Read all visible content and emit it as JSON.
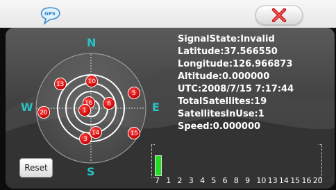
{
  "colors": {
    "accent": "#29c3c3",
    "satellite": "#dd0000",
    "bar": "#22dd22"
  },
  "header": {
    "logo_text": "GPS",
    "close_icon": "close-x-icon"
  },
  "compass": {
    "n": "N",
    "e": "E",
    "s": "S",
    "w": "W"
  },
  "satellites": [
    {
      "id": "10",
      "azimuth_deg": 2,
      "elevation_deg": 45
    },
    {
      "id": "13",
      "azimuth_deg": 308,
      "elevation_deg": 26
    },
    {
      "id": "5",
      "azimuth_deg": 70,
      "elevation_deg": 15
    },
    {
      "id": "6",
      "azimuth_deg": 74,
      "elevation_deg": 59
    },
    {
      "id": "16",
      "azimuth_deg": 338,
      "elevation_deg": 80
    },
    {
      "id": "20",
      "azimuth_deg": 265,
      "elevation_deg": 12
    },
    {
      "id": "1",
      "azimuth_deg": 250,
      "elevation_deg": 79
    },
    {
      "id": "15",
      "azimuth_deg": 120,
      "elevation_deg": 8
    },
    {
      "id": "14",
      "azimuth_deg": 169,
      "elevation_deg": 50
    },
    {
      "id": "3",
      "azimuth_deg": 190,
      "elevation_deg": 39
    }
  ],
  "info": {
    "signal_state": "SignalState:Invalid",
    "latitude": "Latitude:37.566550",
    "longitude": "Longitude:126.966873",
    "altitude": "Altitude:0.000000",
    "utc": "UTC:2008/7/15 7:17:44",
    "total_satellites": "TotalSatellites:19",
    "satellites_in_use": "SatellitesInUse:1",
    "speed": "Speed:0.000000"
  },
  "reset_label": "Reset",
  "signal_chart": {
    "labels": [
      "7",
      "1",
      "2",
      "3",
      "4",
      "5",
      "6",
      "8",
      "9",
      "10",
      "13",
      "14",
      "15",
      "16",
      "20"
    ],
    "values": [
      0.65,
      0,
      0,
      0,
      0,
      0,
      0,
      0,
      0,
      0,
      0,
      0,
      0,
      0,
      0
    ]
  }
}
